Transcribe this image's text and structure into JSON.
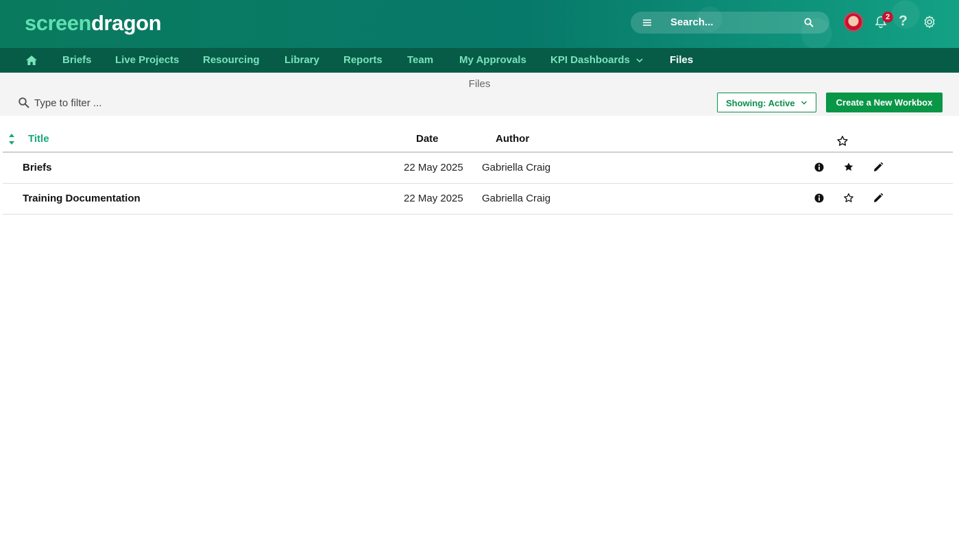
{
  "app": {
    "logo_part1": "screen",
    "logo_part2": "dragon",
    "search_placeholder": "Search...",
    "notification_count": "2",
    "help_label": "?"
  },
  "nav": {
    "items": [
      {
        "label": "Briefs"
      },
      {
        "label": "Live Projects"
      },
      {
        "label": "Resourcing"
      },
      {
        "label": "Library"
      },
      {
        "label": "Reports"
      },
      {
        "label": "Team"
      },
      {
        "label": "My Approvals"
      },
      {
        "label": "KPI Dashboards"
      },
      {
        "label": "Files"
      }
    ],
    "active": "Files"
  },
  "page": {
    "title": "Files",
    "filter_placeholder": "Type to filter ...",
    "showing_label": "Showing: Active",
    "create_label": "Create a New Workbox"
  },
  "table": {
    "headers": {
      "title": "Title",
      "date": "Date",
      "author": "Author"
    },
    "rows": [
      {
        "title": "Briefs",
        "date": "22 May 2025",
        "author": "Gabriella Craig",
        "favorited": true
      },
      {
        "title": "Training Documentation",
        "date": "22 May 2025",
        "author": "Gabriella Craig",
        "favorited": false
      }
    ]
  },
  "colors": {
    "brand_green": "#0a9647",
    "header_teal": "#0a7a5e",
    "nav_dark": "#075c47",
    "accent_mint": "#79e3bb",
    "badge_red": "#c8102e"
  }
}
